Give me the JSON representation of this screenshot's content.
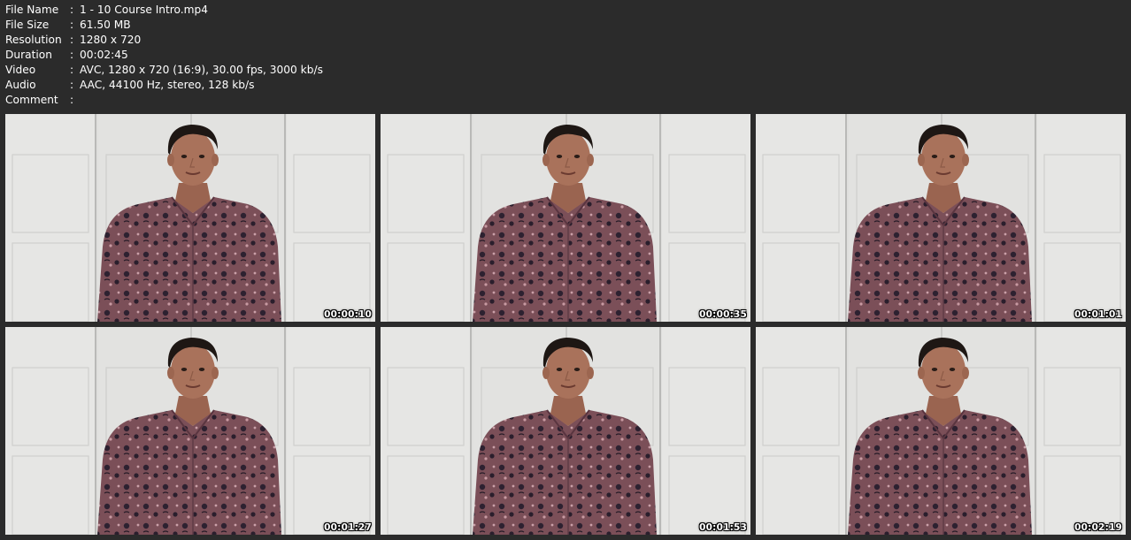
{
  "file_info": [
    {
      "key": "File Name",
      "sep": ":",
      "value": "1 - 10 Course Intro.mp4"
    },
    {
      "key": "File Size",
      "sep": ":",
      "value": "61.50 MB"
    },
    {
      "key": "Resolution",
      "sep": ":",
      "value": "1280 x 720"
    },
    {
      "key": "Duration",
      "sep": ":",
      "value": "00:02:45"
    },
    {
      "key": "Video",
      "sep": ":",
      "value": "AVC, 1280 x 720 (16:9), 30.00 fps, 3000 kb/s"
    },
    {
      "key": "Audio",
      "sep": ":",
      "value": "AAC, 44100 Hz, stereo, 128 kb/s"
    },
    {
      "key": "Comment",
      "sep": ":",
      "value": ""
    }
  ],
  "thumbnails": [
    {
      "timestamp": "00:00:10",
      "icon": "presenter-video-frame"
    },
    {
      "timestamp": "00:00:35",
      "icon": "presenter-video-frame"
    },
    {
      "timestamp": "00:01:01",
      "icon": "presenter-video-frame"
    },
    {
      "timestamp": "00:01:27",
      "icon": "presenter-video-frame"
    },
    {
      "timestamp": "00:01:53",
      "icon": "presenter-video-frame"
    },
    {
      "timestamp": "00:02:19",
      "icon": "presenter-video-frame"
    }
  ],
  "colors": {
    "background": "#2b2b2b",
    "text": "#ffffff",
    "wall": "#e4e4e2",
    "shirt": "#7a4e57",
    "skin": "#a5705a",
    "hair": "#1d1613"
  }
}
